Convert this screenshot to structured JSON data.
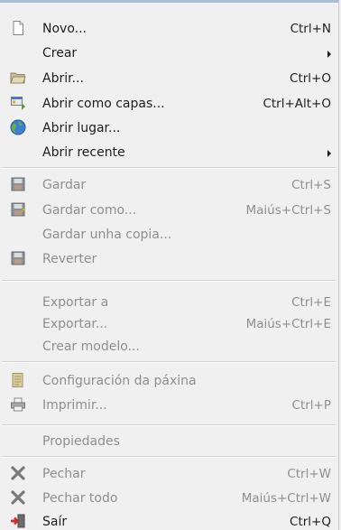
{
  "menu": {
    "items": [
      {
        "label": "Novo...",
        "accel": "Ctrl+N"
      },
      {
        "label": "Crear"
      },
      {
        "label": "Abrir...",
        "accel": "Ctrl+O"
      },
      {
        "label": "Abrir como capas...",
        "accel": "Ctrl+Alt+O"
      },
      {
        "label": "Abrir lugar..."
      },
      {
        "label": "Abrir recente"
      },
      {
        "label": "Gardar",
        "accel": "Ctrl+S"
      },
      {
        "label": "Gardar como...",
        "accel": "Maiús+Ctrl+S"
      },
      {
        "label": "Gardar unha copia..."
      },
      {
        "label": "Reverter"
      },
      {
        "label": "Exportar a",
        "accel": "Ctrl+E"
      },
      {
        "label": "Exportar...",
        "accel": "Maiús+Ctrl+E"
      },
      {
        "label": "Crear modelo..."
      },
      {
        "label": "Configuración da páxina"
      },
      {
        "label": "Imprimir...",
        "accel": "Ctrl+P"
      },
      {
        "label": "Propiedades"
      },
      {
        "label": "Pechar",
        "accel": "Ctrl+W"
      },
      {
        "label": "Pechar todo",
        "accel": "Maiús+Ctrl+W"
      },
      {
        "label": "Saír",
        "accel": "Ctrl+Q"
      }
    ],
    "icons": [
      "new-document-icon",
      "folder-icon",
      "open-as-layers-icon",
      "globe-icon",
      "save-icon",
      "save-as-icon",
      "revert-icon",
      "page-setup-icon",
      "printer-icon",
      "close-icon",
      "close-all-icon",
      "quit-icon"
    ],
    "submenu_arrow_icon": "submenu-arrow-icon",
    "colors": {
      "background": "#f0f0f0",
      "text": "#1e1e1e",
      "disabled_text": "#8f8f8f"
    }
  }
}
